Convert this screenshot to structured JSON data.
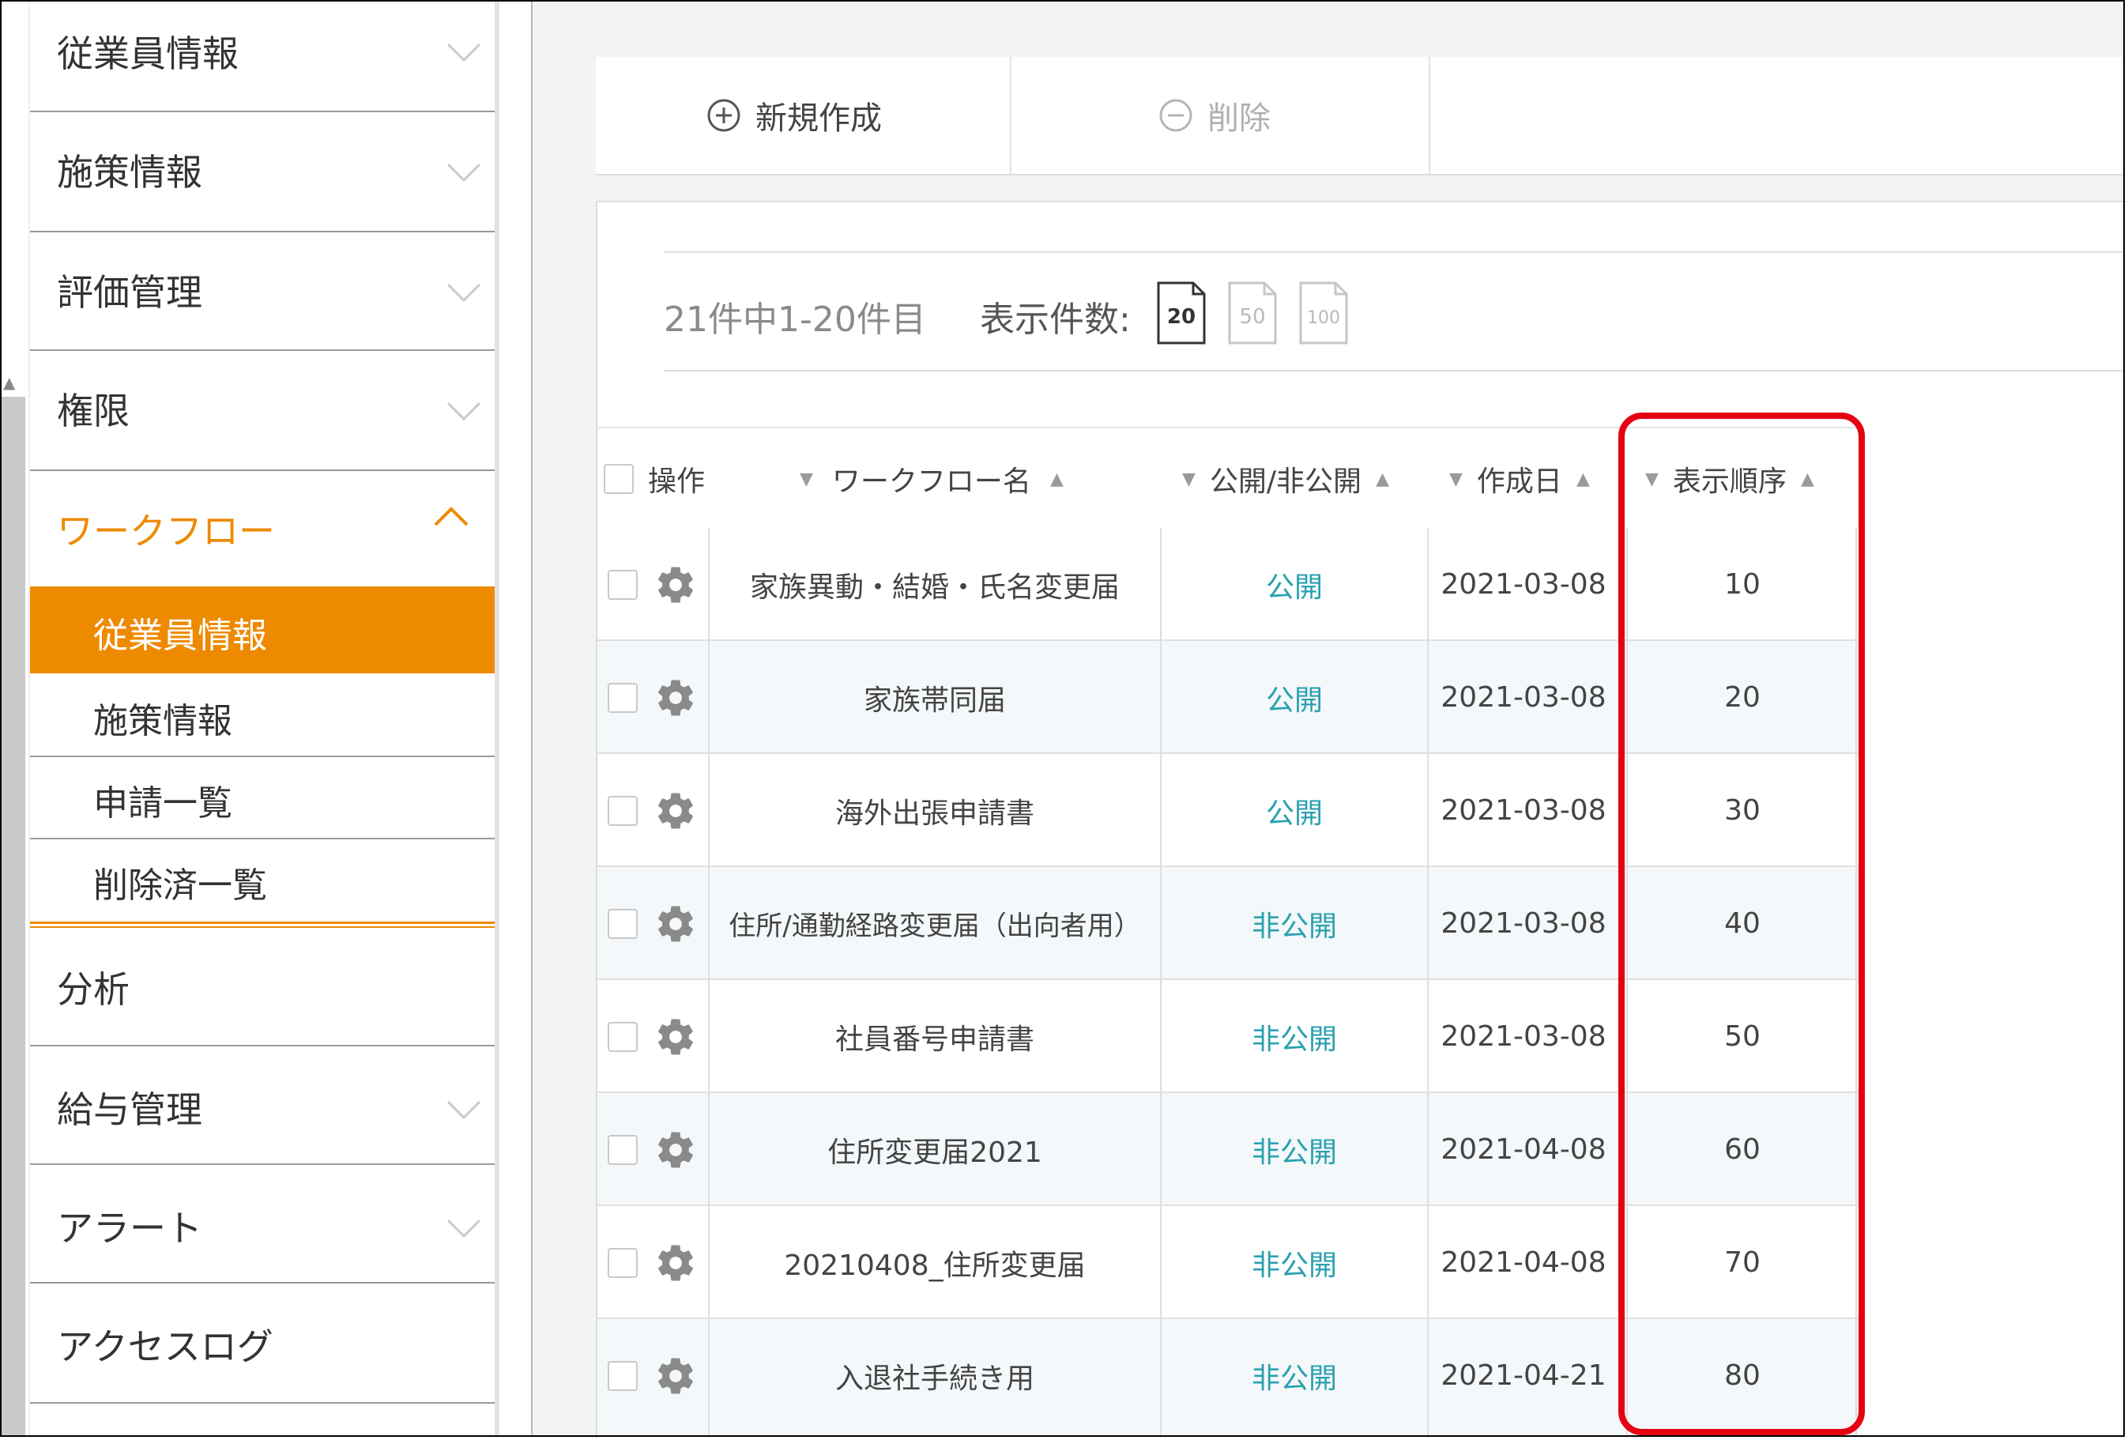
{
  "sidebar": {
    "items": [
      {
        "label": "従業員情報"
      },
      {
        "label": "施策情報"
      },
      {
        "label": "評価管理"
      },
      {
        "label": "権限"
      },
      {
        "label": "ワークフロー"
      },
      {
        "label": "分析"
      },
      {
        "label": "給与管理"
      },
      {
        "label": "アラート"
      },
      {
        "label": "アクセスログ"
      }
    ],
    "subitems": [
      {
        "label": "従業員情報"
      },
      {
        "label": "施策情報"
      },
      {
        "label": "申請一覧"
      },
      {
        "label": "削除済一覧"
      }
    ],
    "accent_color": "#ee8a00"
  },
  "toolbar": {
    "new_label": "新規作成",
    "delete_label": "削除"
  },
  "pager": {
    "summary": "21件中1-20件目",
    "count_label": "表示件数:",
    "options": [
      "20",
      "50",
      "100"
    ],
    "selected": "20"
  },
  "table": {
    "columns": {
      "operation": "操作",
      "name": "ワークフロー名",
      "visibility": "公開/非公開",
      "created": "作成日",
      "order": "表示順序"
    },
    "rows": [
      {
        "name": "家族異動・結婚・氏名変更届",
        "visibility": "公開",
        "created": "2021-03-08",
        "order": "10"
      },
      {
        "name": "家族帯同届",
        "visibility": "公開",
        "created": "2021-03-08",
        "order": "20"
      },
      {
        "name": "海外出張申請書",
        "visibility": "公開",
        "created": "2021-03-08",
        "order": "30"
      },
      {
        "name": "住所/通勤経路変更届（出向者用）",
        "visibility": "非公開",
        "created": "2021-03-08",
        "order": "40"
      },
      {
        "name": "社員番号申請書",
        "visibility": "非公開",
        "created": "2021-03-08",
        "order": "50"
      },
      {
        "name": "住所変更届2021",
        "visibility": "非公開",
        "created": "2021-04-08",
        "order": "60"
      },
      {
        "name": "20210408_住所変更届",
        "visibility": "非公開",
        "created": "2021-04-08",
        "order": "70"
      },
      {
        "name": "入退社手続き用",
        "visibility": "非公開",
        "created": "2021-04-21",
        "order": "80"
      }
    ],
    "visibility_color": "#2aa1b0"
  },
  "highlight_color": "#e60012"
}
